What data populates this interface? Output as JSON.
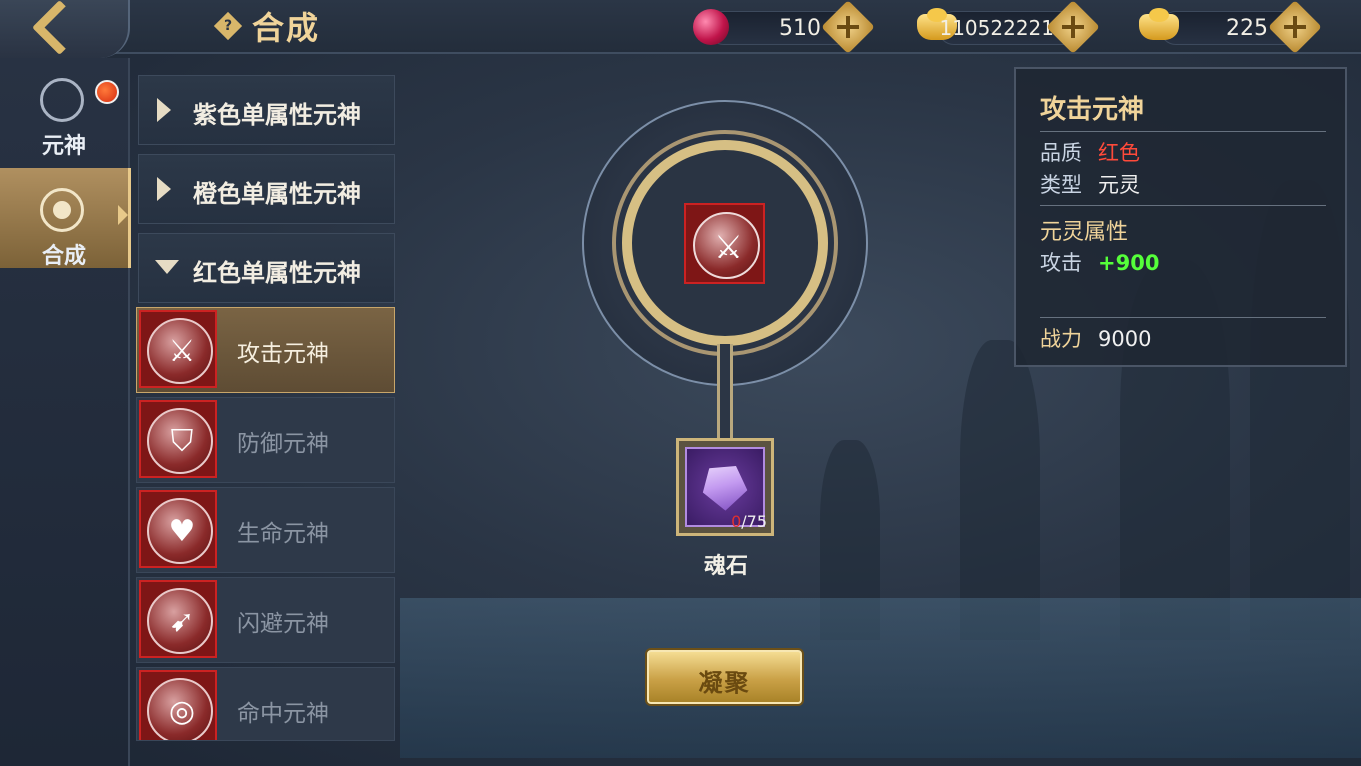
{
  "header": {
    "title": "合成",
    "resources": [
      {
        "icon": "red-gem-icon",
        "value": "510"
      },
      {
        "icon": "gold-ingot-icon",
        "value": "110522221"
      },
      {
        "icon": "gold-ingot-icon",
        "value": "225"
      }
    ]
  },
  "sidebar": {
    "items": [
      {
        "label": "元神",
        "icon": "spirit-icon",
        "badge": true
      },
      {
        "label": "合成",
        "icon": "synthesis-icon",
        "active": true
      }
    ]
  },
  "categories": [
    {
      "label": "紫色单属性元神",
      "expanded": false
    },
    {
      "label": "橙色单属性元神",
      "expanded": false
    },
    {
      "label": "红色单属性元神",
      "expanded": true
    }
  ],
  "items": [
    {
      "label": "攻击元神",
      "icon": "crossed-swords-icon",
      "glyph": "⚔",
      "selected": true
    },
    {
      "label": "防御元神",
      "icon": "shield-icon",
      "glyph": "⛉"
    },
    {
      "label": "生命元神",
      "icon": "heart-icon",
      "glyph": "♥"
    },
    {
      "label": "闪避元神",
      "icon": "running-figure-icon",
      "glyph": "➹"
    },
    {
      "label": "命中元神",
      "icon": "target-icon",
      "glyph": "◎"
    }
  ],
  "center": {
    "glyph": "⚔",
    "material": {
      "name": "魂石",
      "have": "0",
      "need": "/75"
    },
    "button_label": "凝聚"
  },
  "info": {
    "title": "攻击元神",
    "quality_label": "品质",
    "quality_value": "红色",
    "type_label": "类型",
    "type_value": "元灵",
    "attr_header": "元灵属性",
    "attr_label": "攻击",
    "attr_value": "+900",
    "power_label": "战力",
    "power_value": "9000"
  }
}
